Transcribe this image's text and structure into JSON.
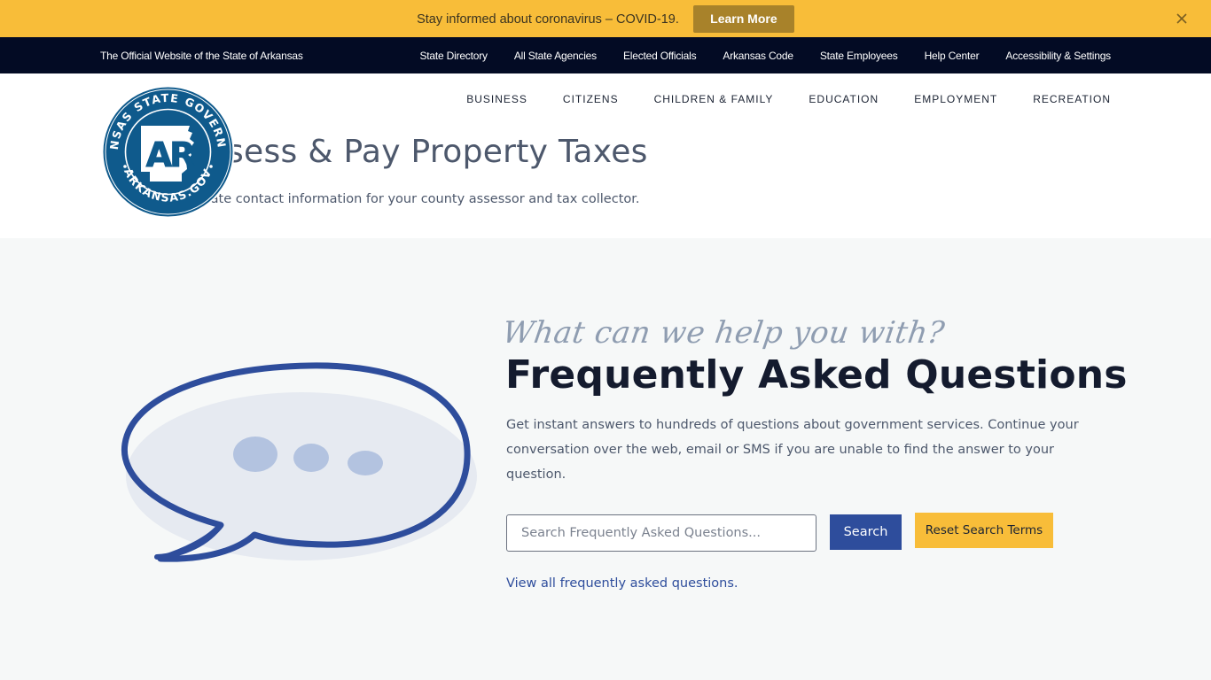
{
  "alert": {
    "message": "Stay informed about coronavirus – COVID-19.",
    "button_label": "Learn More",
    "close_icon": "close-icon"
  },
  "utility_bar": {
    "brand": "The Official Website of the State of Arkansas",
    "links": [
      "State Directory",
      "All State Agencies",
      "Elected Officials",
      "Arkansas Code",
      "State Employees",
      "Help Center",
      "Accessibility & Settings"
    ]
  },
  "header": {
    "logo": {
      "top_text": "ARKANSAS STATE GOVERNMENT",
      "bottom_text": "ARKANSAS.GOV",
      "monogram": "AR"
    },
    "nav": [
      "BUSINESS",
      "CITIZENS",
      "CHILDREN & FAMILY",
      "EDUCATION",
      "EMPLOYMENT",
      "RECREATION"
    ],
    "page_title": "Assess & Pay Property Taxes",
    "page_subtitle": "Locate contact information for your county assessor and tax collector."
  },
  "faq": {
    "script_heading": "What can we help you with?",
    "title": "Frequently Asked Questions",
    "description": "Get instant answers to hundreds of questions about government services. Continue your conversation over the web, email or SMS if you are unable to find the answer to your question.",
    "search_placeholder": "Search Frequently Asked Questions...",
    "search_value": "",
    "search_button": "Search",
    "reset_button": "Reset Search Terms",
    "view_all_link": "View all frequently asked questions.",
    "illustration_icon": "chat-bubble-icon"
  },
  "colors": {
    "alert_bg": "#f8bd39",
    "alert_button": "#a8822a",
    "utility_bg": "#030b24",
    "brand_blue": "#2e4d9c",
    "logo_blue": "#0f5a8c",
    "page_bg": "#f6f8f8"
  }
}
